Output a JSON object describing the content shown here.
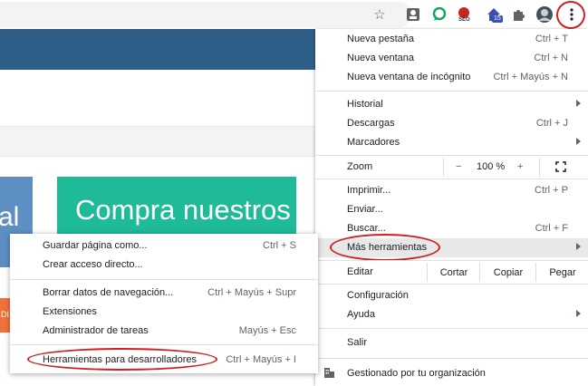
{
  "page": {
    "blue_card_text": "al",
    "green_card_text": "Compra nuestros",
    "orange_button_text": "DI"
  },
  "toolbar": {
    "star_icon": "star-icon",
    "extensions": [
      "profile-card-extension",
      "chat-extension",
      "seo-extension",
      "home-badge-extension",
      "puzzle-extension"
    ],
    "seo_label": "SEO",
    "badge_count": "15"
  },
  "menu": {
    "items": {
      "new_tab": {
        "label": "Nueva pestaña",
        "shortcut": "Ctrl + T"
      },
      "new_window": {
        "label": "Nueva ventana",
        "shortcut": "Ctrl + N"
      },
      "incognito": {
        "label": "Nueva ventana de incógnito",
        "shortcut": "Ctrl + Mayús + N"
      },
      "history": {
        "label": "Historial"
      },
      "downloads": {
        "label": "Descargas",
        "shortcut": "Ctrl + J"
      },
      "bookmarks": {
        "label": "Marcadores"
      },
      "zoom": {
        "label": "Zoom",
        "minus": "−",
        "value": "100 %",
        "plus": "+"
      },
      "print": {
        "label": "Imprimir...",
        "shortcut": "Ctrl + P"
      },
      "send": {
        "label": "Enviar..."
      },
      "find": {
        "label": "Buscar...",
        "shortcut": "Ctrl + F"
      },
      "more_tools": {
        "label": "Más herramientas"
      },
      "edit": {
        "label": "Editar",
        "cut": "Cortar",
        "copy": "Copiar",
        "paste": "Pegar"
      },
      "settings": {
        "label": "Configuración"
      },
      "help": {
        "label": "Ayuda"
      },
      "exit": {
        "label": "Salir"
      },
      "managed": {
        "label": "Gestionado por tu organización"
      }
    }
  },
  "submenu": {
    "items": [
      {
        "label": "Guardar página como...",
        "shortcut": "Ctrl + S"
      },
      {
        "label": "Crear acceso directo..."
      },
      {
        "label": "Borrar datos de navegación...",
        "shortcut": "Ctrl + Mayús + Supr"
      },
      {
        "label": "Extensiones"
      },
      {
        "label": "Administrador de tareas",
        "shortcut": "Mayús + Esc"
      },
      {
        "label": "Herramientas para desarrolladores",
        "shortcut": "Ctrl + Mayús + I"
      }
    ]
  },
  "colors": {
    "highlight": "#d21f1f",
    "hover_row": "#e8e8e8",
    "hero_blue": "#2e5e88",
    "green_card": "#1fba98"
  }
}
